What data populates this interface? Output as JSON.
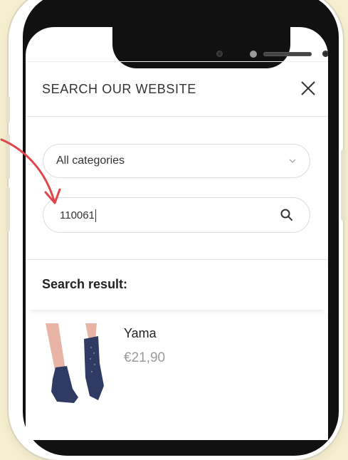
{
  "header": {
    "title": "SEARCH OUR WEBSITE"
  },
  "category_select": {
    "selected": "All categories"
  },
  "search": {
    "value": "110061"
  },
  "results": {
    "heading": "Search result:",
    "items": [
      {
        "name": "Yama",
        "price": "€21,90"
      }
    ]
  },
  "colors": {
    "background": "#f6efcf",
    "arrow": "#e0464b",
    "sock": "#2f3b62",
    "skin": "#e7b4a6"
  }
}
